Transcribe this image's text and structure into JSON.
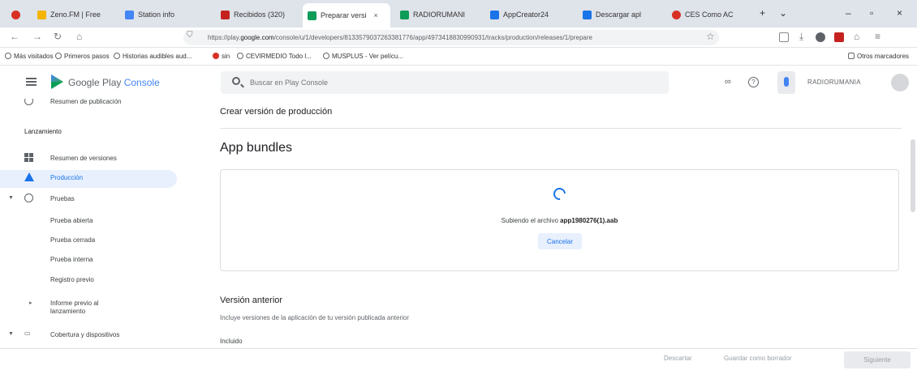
{
  "browser": {
    "tabs": [
      {
        "label": "Zeno.FM | Free",
        "color": "#f4b400"
      },
      {
        "label": "Station info",
        "color": "#4285f4"
      },
      {
        "label": "Recibidos (320)",
        "color": "#5f6368"
      },
      {
        "label": "Preparar versi",
        "color": "#0e9d58"
      },
      {
        "label": "RADIORUMANI",
        "color": "#0e9d58"
      },
      {
        "label": "AppCreator24",
        "color": "#1a73e8"
      },
      {
        "label": "Descargar apl",
        "color": "#1a73e8"
      },
      {
        "label": "CES Como AC",
        "color": "#d93025"
      }
    ],
    "active_tab_close": "×",
    "url_prefix": "https://play.",
    "url_domain": "google.com",
    "url_rest": "/console/u/1/developers/8133579037263381776/app/4973418830990931/tracks/production/releases/1/prepare"
  },
  "bookmarks": [
    "Más visitados",
    "Primeros pasos",
    "Historias audibles aud...",
    "sin",
    "CEVIRMEDIO Todo l...",
    "MUSPLUS - Ver pelícu..."
  ],
  "bookmarks_other": "Otros marcadores",
  "header": {
    "brand": "Google Play",
    "brand_accent": "Console",
    "search_placeholder": "Buscar en Play Console",
    "link_icon": "∞",
    "help_icon": "?",
    "developer": "RADIORUMANIA"
  },
  "sidebar": {
    "top_item": "Resumen de publicación",
    "section": "Lanzamiento",
    "items": {
      "resumen": "Resumen de versiones",
      "produccion": "Producción",
      "pruebas": "Pruebas",
      "abierta": "Prueba abierta",
      "cerrada": "Prueba cerrada",
      "interna": "Prueba interna",
      "registro": "Registro previo",
      "informe1": "Informe previo al",
      "informe2": "lanzamiento",
      "cobertura": "Cobertura y dispositivos"
    }
  },
  "main": {
    "title": "Crear versión de producción",
    "bundles_title": "App bundles",
    "uploading_text": "Subiendo el archivo",
    "file_name": "app1980276(1).aab",
    "cancel": "Cancelar",
    "prev_title": "Versión anterior",
    "prev_desc": "Incluye versiones de la aplicación de tu versión publicada anterior",
    "included": "Incluido"
  },
  "footer": {
    "discard": "Descartar",
    "save_draft": "Guardar como borrador",
    "next": "Siguiente"
  }
}
